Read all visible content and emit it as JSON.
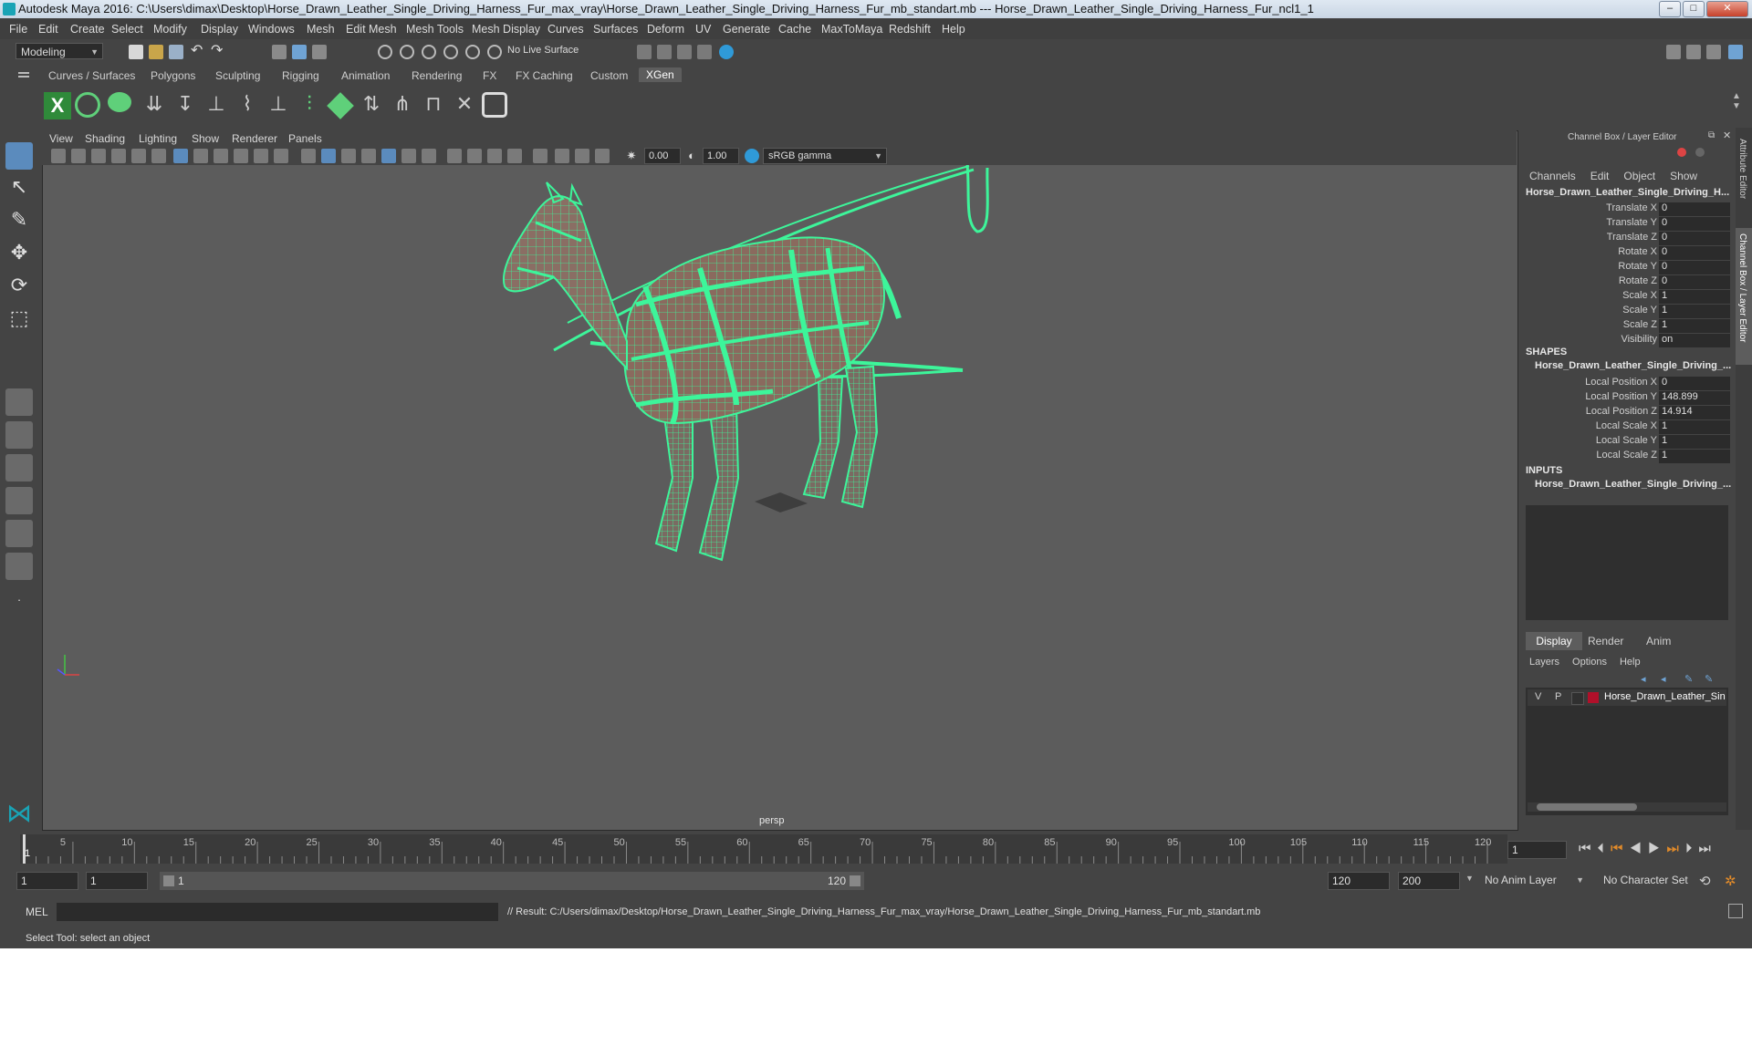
{
  "window": {
    "title": "Autodesk Maya 2016: C:\\Users\\dimax\\Desktop\\Horse_Drawn_Leather_Single_Driving_Harness_Fur_max_vray\\Horse_Drawn_Leather_Single_Driving_Harness_Fur_mb_standart.mb   ---   Horse_Drawn_Leather_Single_Driving_Harness_Fur_ncl1_1"
  },
  "menu": [
    "File",
    "Edit",
    "Create",
    "Select",
    "Modify",
    "Display",
    "Windows",
    "Mesh",
    "Edit Mesh",
    "Mesh Tools",
    "Mesh Display",
    "Curves",
    "Surfaces",
    "Deform",
    "UV",
    "Generate",
    "Cache",
    "MaxToMaya",
    "Redshift",
    "Help"
  ],
  "status_line": {
    "mode": "Modeling",
    "live_surface": "No Live Surface"
  },
  "shelf_tabs": [
    "Curves / Surfaces",
    "Polygons",
    "Sculpting",
    "Rigging",
    "Animation",
    "Rendering",
    "FX",
    "FX Caching",
    "Custom",
    "XGen"
  ],
  "shelf_active": "XGen",
  "viewport": {
    "menu": [
      "View",
      "Shading",
      "Lighting",
      "Show",
      "Renderer",
      "Panels"
    ],
    "exposure": "0.00",
    "gamma": "1.00",
    "color_space": "sRGB gamma",
    "camera_label": "persp"
  },
  "channel_box": {
    "header": "Channel Box / Layer Editor",
    "menu": [
      "Channels",
      "Edit",
      "Object",
      "Show"
    ],
    "object_name": "Horse_Drawn_Leather_Single_Driving_H...",
    "transform": [
      {
        "label": "Translate X",
        "value": "0"
      },
      {
        "label": "Translate Y",
        "value": "0"
      },
      {
        "label": "Translate Z",
        "value": "0"
      },
      {
        "label": "Rotate X",
        "value": "0"
      },
      {
        "label": "Rotate Y",
        "value": "0"
      },
      {
        "label": "Rotate Z",
        "value": "0"
      },
      {
        "label": "Scale X",
        "value": "1"
      },
      {
        "label": "Scale Y",
        "value": "1"
      },
      {
        "label": "Scale Z",
        "value": "1"
      },
      {
        "label": "Visibility",
        "value": "on"
      }
    ],
    "shapes_title": "SHAPES",
    "shape_name": "Horse_Drawn_Leather_Single_Driving_...",
    "shape_attrs": [
      {
        "label": "Local Position X",
        "value": "0"
      },
      {
        "label": "Local Position Y",
        "value": "148.899"
      },
      {
        "label": "Local Position Z",
        "value": "14.914"
      },
      {
        "label": "Local Scale X",
        "value": "1"
      },
      {
        "label": "Local Scale Y",
        "value": "1"
      },
      {
        "label": "Local Scale Z",
        "value": "1"
      }
    ],
    "inputs_title": "INPUTS",
    "input_name": "Horse_Drawn_Leather_Single_Driving_..."
  },
  "layer_editor": {
    "tabs": [
      "Display",
      "Render",
      "Anim"
    ],
    "active_tab": "Display",
    "menu": [
      "Layers",
      "Options",
      "Help"
    ],
    "layer": {
      "v": "V",
      "p": "P",
      "name": "Horse_Drawn_Leather_Sin",
      "color": "#b0102a"
    }
  },
  "side_tabs": [
    "Attribute Editor",
    "Channel Box / Layer Editor"
  ],
  "timeline": {
    "ticks": [
      "5",
      "10",
      "15",
      "20",
      "25",
      "30",
      "35",
      "40",
      "45",
      "50",
      "55",
      "60",
      "65",
      "70",
      "75",
      "80",
      "85",
      "90",
      "95",
      "100",
      "105",
      "110",
      "115",
      "120"
    ],
    "current_frame": "1",
    "current_field": "1"
  },
  "range": {
    "start": "1",
    "playback_start": "1",
    "slider_start": "1",
    "slider_end": "120",
    "playback_end": "120",
    "end": "200",
    "anim_layer": "No Anim Layer",
    "character_set": "No Character Set"
  },
  "command": {
    "lang": "MEL",
    "result": "// Result: C:/Users/dimax/Desktop/Horse_Drawn_Leather_Single_Driving_Harness_Fur_max_vray/Horse_Drawn_Leather_Single_Driving_Harness_Fur_mb_standart.mb"
  },
  "help_line": "Select Tool: select an object",
  "colors": {
    "wireframe": "#3df59a",
    "viewport_bg": "#5c5c5c",
    "ui_bg": "#444444"
  }
}
